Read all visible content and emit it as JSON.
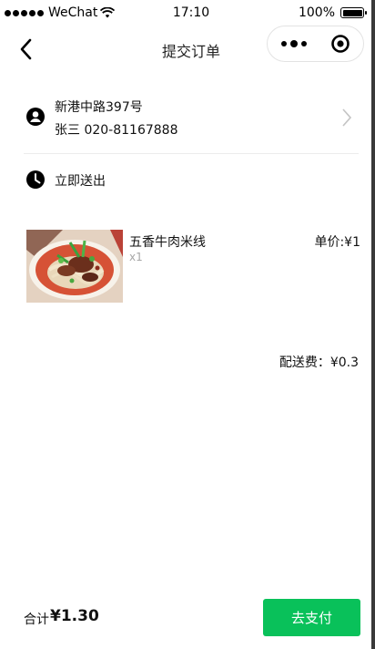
{
  "status_bar": {
    "carrier": "WeChat",
    "time": "17:10",
    "battery": "100%",
    "battery_level": 1.0
  },
  "nav": {
    "title": "提交订单"
  },
  "address": {
    "line1": "新港中路397号",
    "line2": "张三 020-81167888"
  },
  "delivery": {
    "label": "立即送出"
  },
  "product": {
    "name": "五香牛肉米线",
    "quantity": "x1",
    "price": "单价:¥1"
  },
  "fee": "配送费：¥0.3",
  "footer": {
    "total_label": "合计",
    "total_value": "¥1.30",
    "pay_button": "去支付"
  },
  "colors": {
    "accent": "#09c15a",
    "muted_text": "#a7a7a7"
  }
}
